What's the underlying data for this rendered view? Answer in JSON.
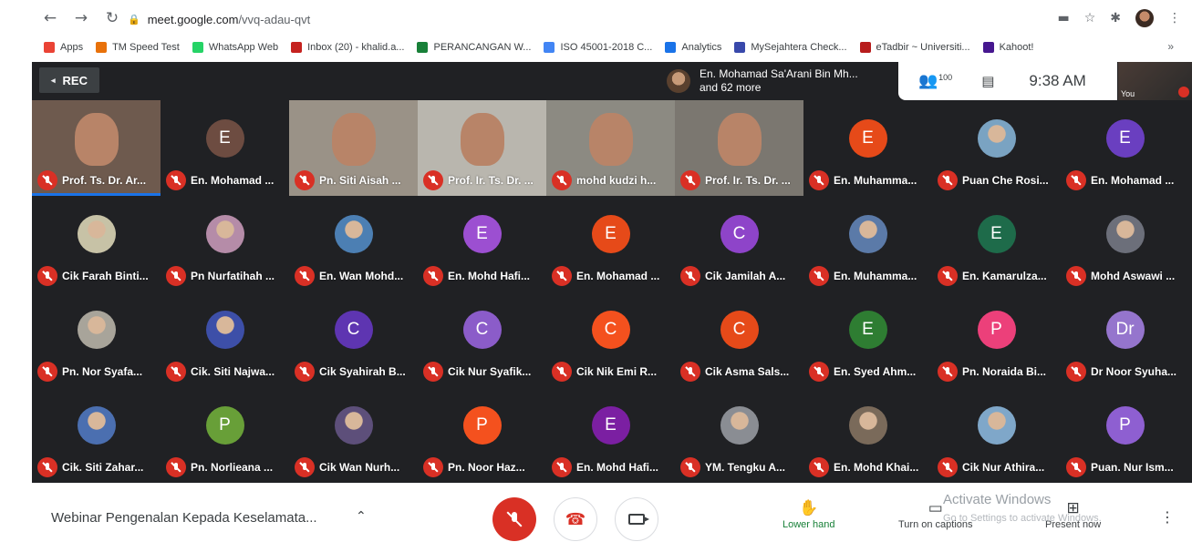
{
  "browser": {
    "url_domain": "meet.google.com",
    "url_path": "/vvq-adau-qvt",
    "bookmarks": [
      {
        "label": "Apps",
        "color": "#ea4335"
      },
      {
        "label": "TM Speed Test",
        "color": "#e8710a"
      },
      {
        "label": "WhatsApp Web",
        "color": "#25d366"
      },
      {
        "label": "Inbox (20) - khalid.a...",
        "color": "#c5221f"
      },
      {
        "label": "PERANCANGAN W...",
        "color": "#188038"
      },
      {
        "label": "ISO 45001-2018 C...",
        "color": "#4285f4"
      },
      {
        "label": "Analytics",
        "color": "#1a73e8"
      },
      {
        "label": "MySejahtera Check...",
        "color": "#3949ab"
      },
      {
        "label": "eTadbir ~ Universiti...",
        "color": "#b71c1c"
      },
      {
        "label": "Kahoot!",
        "color": "#46178f"
      }
    ]
  },
  "meet": {
    "rec_label": "REC",
    "presenter_line1": "En. Mohamad Sa'Arani Bin Mh...",
    "presenter_line2": "and 62 more",
    "people_count": "100",
    "time": "9:38 AM",
    "self_label": "You",
    "tiles": [
      {
        "name": "Prof. Ts. Dr. Ar...",
        "type": "video",
        "bg": "#6e5a4e",
        "speaking": true
      },
      {
        "name": "En. Mohamad ...",
        "type": "avatar",
        "letter": "E",
        "color": "#6d4c41"
      },
      {
        "name": "Pn. Siti Aisah ...",
        "type": "video",
        "bg": "#9a9287"
      },
      {
        "name": "Prof. Ir. Ts. Dr. ...",
        "type": "video",
        "bg": "#b9b6ae"
      },
      {
        "name": "mohd kudzi h...",
        "type": "video",
        "bg": "#8c8a82"
      },
      {
        "name": "Prof. Ir. Ts. Dr. ...",
        "type": "video",
        "bg": "#7b7770"
      },
      {
        "name": "En. Muhamma...",
        "type": "avatar",
        "letter": "E",
        "color": "#e64a19"
      },
      {
        "name": "Puan Che Rosi...",
        "type": "photo",
        "color": "#7aa3c2"
      },
      {
        "name": "En. Mohamad ...",
        "type": "avatar",
        "letter": "E",
        "color": "#6a3fc0"
      },
      {
        "name": "Cik Farah Binti...",
        "type": "photo",
        "color": "#c7c2a6"
      },
      {
        "name": "Pn Nurfatihah ...",
        "type": "photo",
        "color": "#b58ca8"
      },
      {
        "name": "En. Wan Mohd...",
        "type": "photo",
        "color": "#4c7fb3"
      },
      {
        "name": "En. Mohd Hafi...",
        "type": "avatar",
        "letter": "E",
        "color": "#9c4fd1"
      },
      {
        "name": "En. Mohamad ...",
        "type": "avatar",
        "letter": "E",
        "color": "#e64a19"
      },
      {
        "name": "Cik Jamilah A...",
        "type": "avatar",
        "letter": "C",
        "color": "#8e44c9"
      },
      {
        "name": "En. Muhamma...",
        "type": "photo",
        "color": "#5b7aa8"
      },
      {
        "name": "En. Kamarulza...",
        "type": "avatar",
        "letter": "E",
        "color": "#1e6b4a"
      },
      {
        "name": "Mohd Aswawi ...",
        "type": "photo",
        "color": "#6c6f7a"
      },
      {
        "name": "Pn. Nor Syafa...",
        "type": "photo",
        "color": "#a8a49a"
      },
      {
        "name": "Cik. Siti Najwa...",
        "type": "photo",
        "color": "#3d4fa8"
      },
      {
        "name": "Cik Syahirah B...",
        "type": "avatar",
        "letter": "C",
        "color": "#5e35b1"
      },
      {
        "name": "Cik Nur Syafik...",
        "type": "avatar",
        "letter": "C",
        "color": "#8b5cc9"
      },
      {
        "name": "Cik Nik Emi R...",
        "type": "avatar",
        "letter": "C",
        "color": "#f4511e"
      },
      {
        "name": "Cik Asma Sals...",
        "type": "avatar",
        "letter": "C",
        "color": "#e64a19"
      },
      {
        "name": "En. Syed Ahm...",
        "type": "avatar",
        "letter": "E",
        "color": "#2e7d32"
      },
      {
        "name": "Pn. Noraida Bi...",
        "type": "avatar",
        "letter": "P",
        "color": "#ec407a"
      },
      {
        "name": "Dr Noor Syuha...",
        "type": "avatar",
        "letter": "Dr",
        "color": "#9575cd"
      },
      {
        "name": "Cik. Siti Zahar...",
        "type": "photo",
        "color": "#4b6fb0"
      },
      {
        "name": "Pn. Norlieana ...",
        "type": "avatar",
        "letter": "P",
        "color": "#689f38"
      },
      {
        "name": "Cik Wan Nurh...",
        "type": "photo",
        "color": "#5d4f7a"
      },
      {
        "name": "Pn. Noor Haz...",
        "type": "avatar",
        "letter": "P",
        "color": "#f4511e"
      },
      {
        "name": "En. Mohd Hafi...",
        "type": "avatar",
        "letter": "E",
        "color": "#7b1fa2"
      },
      {
        "name": "YM. Tengku A...",
        "type": "photo",
        "color": "#8a8d93"
      },
      {
        "name": "En. Mohd Khai...",
        "type": "photo",
        "color": "#7a6a5a"
      },
      {
        "name": "Cik Nur Athira...",
        "type": "photo",
        "color": "#7fa7c9"
      },
      {
        "name": "Puan. Nur Ism...",
        "type": "avatar",
        "letter": "P",
        "color": "#8e5fd1"
      }
    ]
  },
  "toolbar": {
    "meeting_title": "Webinar Pengenalan Kepada Keselamata...",
    "lower_hand": "Lower hand",
    "captions": "Turn on captions",
    "present": "Present now",
    "watermark_title": "Activate Windows",
    "watermark_sub": "Go to Settings to activate Windows."
  }
}
